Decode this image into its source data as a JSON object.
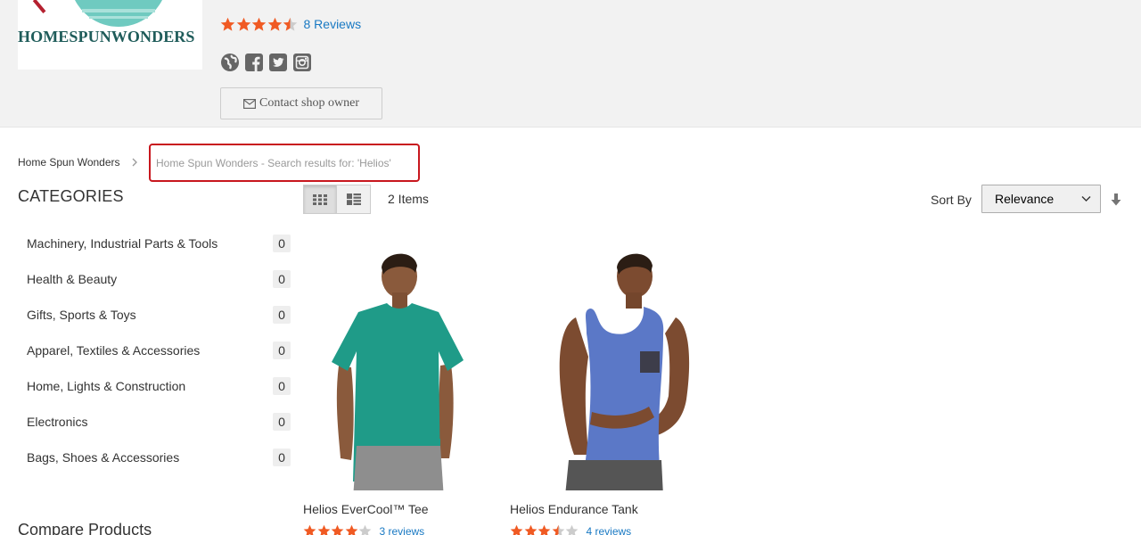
{
  "shop": {
    "logo_text": "HOMESPUNWONDERS",
    "rating": 4.5,
    "reviews_label": "8 Reviews",
    "social_icons": [
      "globe-icon",
      "facebook-icon",
      "twitter-icon",
      "instagram-icon"
    ],
    "contact_label": "Contact shop owner",
    "contact_icon": "envelope-icon"
  },
  "breadcrumb": {
    "home": "Home Spun Wonders",
    "current": "Home Spun Wonders - Search results for: 'Helios'"
  },
  "sidebar": {
    "categories_title": "CATEGORIES",
    "categories": [
      {
        "label": "Machinery, Industrial Parts & Tools",
        "count": "0"
      },
      {
        "label": "Health & Beauty",
        "count": "0"
      },
      {
        "label": "Gifts, Sports & Toys",
        "count": "0"
      },
      {
        "label": "Apparel, Textiles & Accessories",
        "count": "0"
      },
      {
        "label": "Home, Lights & Construction",
        "count": "0"
      },
      {
        "label": "Electronics",
        "count": "0"
      },
      {
        "label": "Bags, Shoes & Accessories",
        "count": "0"
      }
    ],
    "compare_title": "Compare Products"
  },
  "toolbar": {
    "view_modes": [
      "grid-view-icon",
      "list-view-icon"
    ],
    "active_mode": "grid",
    "items_count": "2 Items",
    "sort_label": "Sort By",
    "sort_value": "Relevance",
    "sort_direction_icon": "arrow-down-icon"
  },
  "products": [
    {
      "name": "Helios EverCool™ Tee",
      "rating": 4,
      "reviews": "3 reviews",
      "shirt_color": "#1f9b88"
    },
    {
      "name": "Helios Endurance Tank",
      "rating": 3.5,
      "reviews": "4 reviews",
      "shirt_color": "#5b78c7"
    }
  ],
  "colors": {
    "star": "#f05a23",
    "star_empty": "#cccccc",
    "link": "#1979c3",
    "highlight": "#c8171e",
    "header_bg": "#f2f2f2"
  }
}
